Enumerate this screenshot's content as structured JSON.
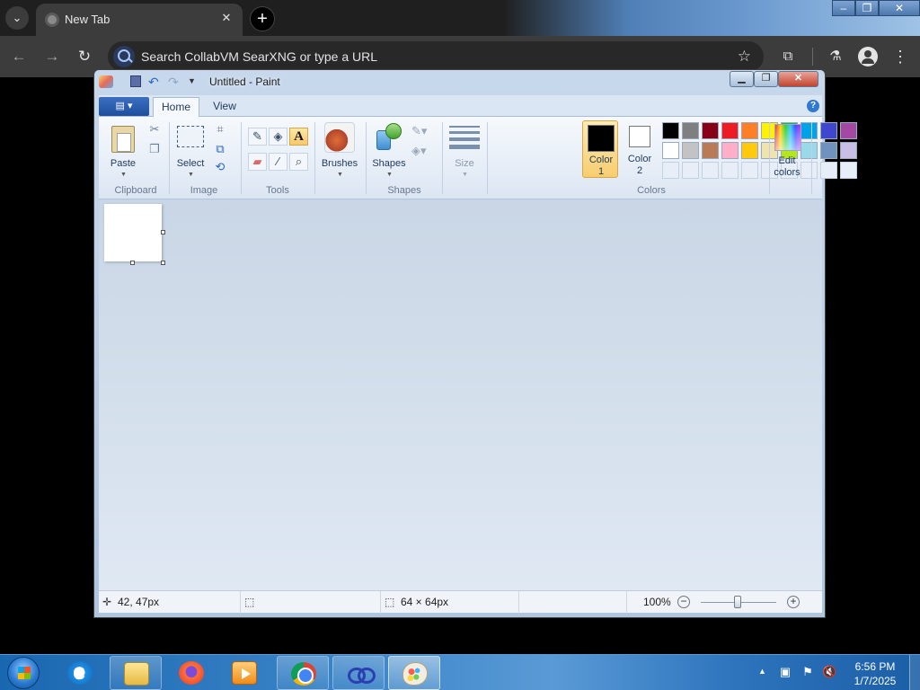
{
  "browser": {
    "tab": {
      "title": "New Tab"
    },
    "omnibox": {
      "placeholder": "Search CollabVM SearXNG or type a URL"
    }
  },
  "paint": {
    "title": "Untitled - Paint",
    "ribbon_tabs": {
      "home": "Home",
      "view": "View"
    },
    "groups": {
      "clipboard": {
        "label": "Clipboard",
        "paste": "Paste"
      },
      "image": {
        "label": "Image",
        "select": "Select"
      },
      "tools": {
        "label": "Tools",
        "text_tool_glyph": "A"
      },
      "brushes": {
        "label": "Brushes"
      },
      "shapes": {
        "label": "Shapes",
        "button": "Shapes"
      },
      "size": {
        "label": "Size"
      },
      "colors": {
        "label": "Colors",
        "color1_line1": "Color",
        "color1_line2": "1",
        "color2_line1": "Color",
        "color2_line2": "2",
        "edit_line1": "Edit",
        "edit_line2": "colors",
        "color1_value": "#000000",
        "color2_value": "#ffffff",
        "palette_row1": [
          "#000000",
          "#7f7f7f",
          "#880015",
          "#ed1c24",
          "#ff7f27",
          "#fff200",
          "#22b14c",
          "#00a2e8",
          "#3f48cc",
          "#a349a4"
        ],
        "palette_row2": [
          "#ffffff",
          "#c3c3c3",
          "#b97a57",
          "#ffaec9",
          "#ffc90e",
          "#efe4b0",
          "#b5e61d",
          "#99d9ea",
          "#7092be",
          "#c8bfe7"
        ]
      }
    },
    "status": {
      "cursor_pos": "42, 47px",
      "image_size": "64 × 64px",
      "zoom": "100%"
    }
  },
  "taskbar": {
    "clock_time": "6:56 PM",
    "clock_date": "1/7/2025"
  }
}
